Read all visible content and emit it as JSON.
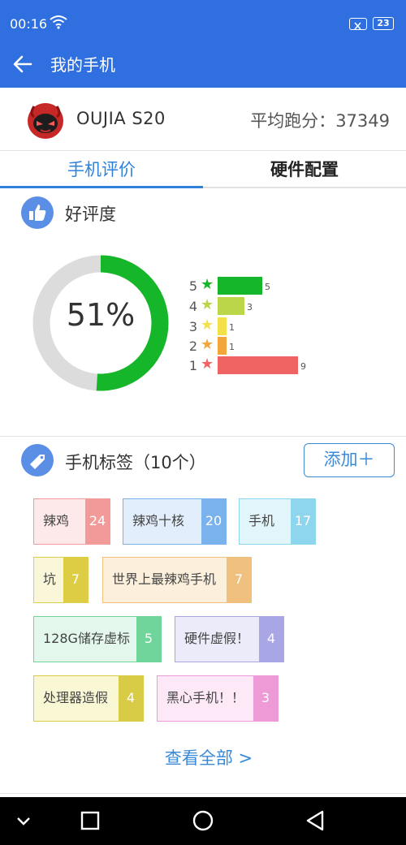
{
  "status_bar": {
    "time": "00:16",
    "battery": "23"
  },
  "app_bar": {
    "title": "我的手机"
  },
  "device": {
    "name": "OUJIA S20",
    "score_label": "平均跑分：",
    "score": "37349"
  },
  "tabs": [
    {
      "label": "手机评价"
    },
    {
      "label": "硬件配置"
    }
  ],
  "rating_section": {
    "title": "好评度",
    "percent_label": "51%",
    "percent": 51,
    "rows": [
      {
        "stars": "5",
        "count": "5",
        "value": 5,
        "color": "#16b62a"
      },
      {
        "stars": "4",
        "count": "3",
        "value": 3,
        "color": "#bcd64a"
      },
      {
        "stars": "3",
        "count": "1",
        "value": 1,
        "color": "#f4e14a"
      },
      {
        "stars": "2",
        "count": "1",
        "value": 1,
        "color": "#f3a73a"
      },
      {
        "stars": "1",
        "count": "9",
        "value": 9,
        "color": "#f06363"
      }
    ]
  },
  "tags_section": {
    "title": "手机标签（10个）",
    "add_label": "添加＋",
    "tags": [
      {
        "label": "辣鸡",
        "count": "24",
        "bg": "#fde9e9",
        "border": "#f39b9b",
        "accent": "#f29a9a"
      },
      {
        "label": "辣鸡十核",
        "count": "20",
        "bg": "#e3eefc",
        "border": "#7ab2ee",
        "accent": "#7ab2ee"
      },
      {
        "label": "手机",
        "count": "17",
        "bg": "#e2f5fb",
        "border": "#8dd6ee",
        "accent": "#8dd6ee"
      },
      {
        "label": "坑",
        "count": "7",
        "bg": "#f9f6d9",
        "border": "#dcd04a",
        "accent": "#dccd45"
      },
      {
        "label": "世界上最辣鸡手机",
        "count": "7",
        "bg": "#fcf0dc",
        "border": "#efc07e",
        "accent": "#efc07e"
      },
      {
        "label": "128G储存虚标",
        "count": "5",
        "bg": "#e3f7ec",
        "border": "#6fd59b",
        "accent": "#6fd59b"
      },
      {
        "label": "硬件虚假！",
        "count": "4",
        "bg": "#ecebfa",
        "border": "#a9a6e6",
        "accent": "#a9a6e6"
      },
      {
        "label": "处理器造假",
        "count": "4",
        "bg": "#faf7d4",
        "border": "#d8cb45",
        "accent": "#d8cb45"
      },
      {
        "label": "黑心手机！！",
        "count": "3",
        "bg": "#fce8f6",
        "border": "#ee9ad6",
        "accent": "#ee9ad6"
      }
    ],
    "view_all": "查看全部 >"
  }
}
